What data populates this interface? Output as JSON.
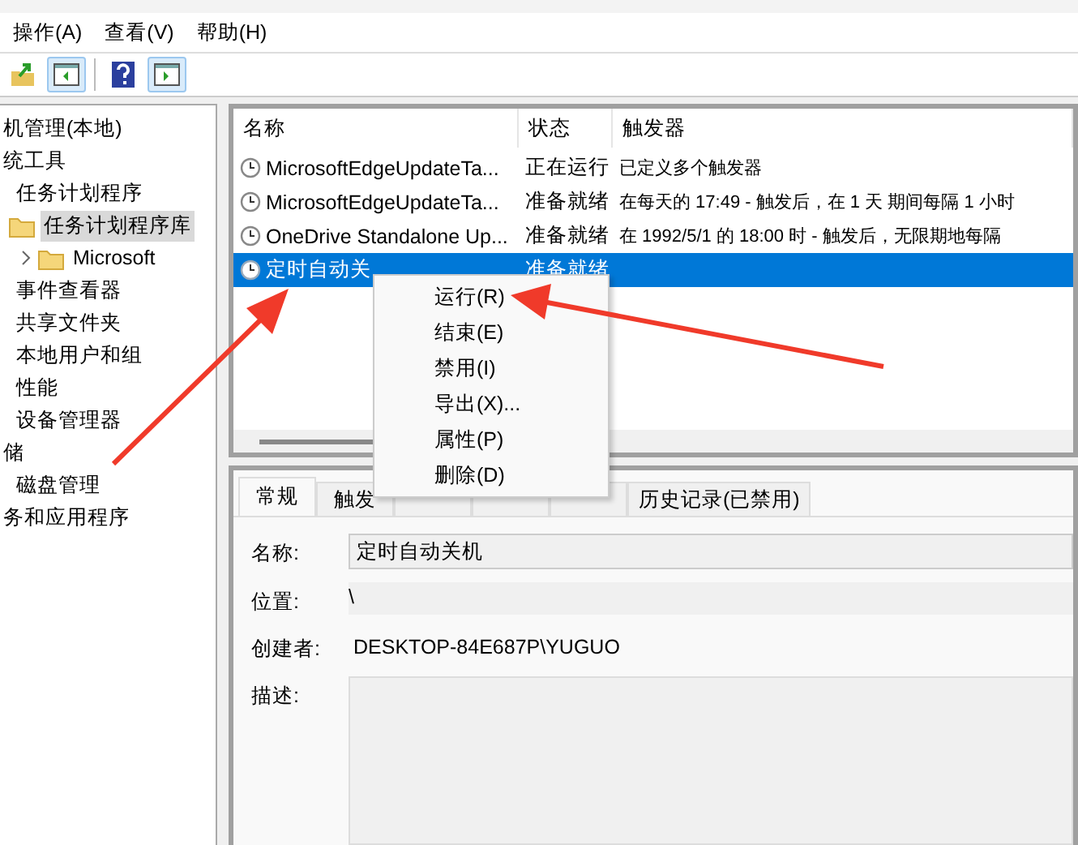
{
  "menu_bar": [
    "操作(A)",
    "查看(V)",
    "帮助(H)"
  ],
  "toolbar": [
    {
      "kind": "up",
      "pressed": false
    },
    {
      "kind": "tree",
      "pressed": true
    },
    {
      "kind": "help",
      "pressed": false
    },
    {
      "kind": "actions",
      "pressed": true
    }
  ],
  "tree": [
    {
      "label": "机管理(本地)",
      "selected": false,
      "children": [
        {
          "label": "统工具",
          "selected": false,
          "children": [
            {
              "label": "任务计划程序",
              "selected": false,
              "children": [
                {
                  "label": "任务计划程序库",
                  "selected": true,
                  "children": [
                    {
                      "label": "Microsoft",
                      "selected": false,
                      "expanded": false
                    }
                  ]
                }
              ]
            },
            {
              "label": "事件查看器",
              "selected": false
            },
            {
              "label": "共享文件夹",
              "selected": false
            },
            {
              "label": "本地用户和组",
              "selected": false
            },
            {
              "label": "性能",
              "selected": false
            },
            {
              "label": "设备管理器",
              "selected": false
            }
          ]
        },
        {
          "label": "储",
          "selected": false,
          "children": [
            {
              "label": "磁盘管理",
              "selected": false
            }
          ]
        },
        {
          "label": "务和应用程序",
          "selected": false
        }
      ]
    }
  ],
  "table": {
    "columns": [
      "名称",
      "状态",
      "触发器"
    ],
    "rows": [
      {
        "name": "MicrosoftEdgeUpdateTa...",
        "status": "正在运行",
        "trigger": "已定义多个触发器",
        "selected": false
      },
      {
        "name": "MicrosoftEdgeUpdateTa...",
        "status": "准备就绪",
        "trigger": "在每天的 17:49 - 触发后，在 1 天 期间每隔 1 小时",
        "selected": false
      },
      {
        "name": "OneDrive Standalone Up...",
        "status": "准备就绪",
        "trigger": "在 1992/5/1 的 18:00 时 - 触发后，无限期地每隔",
        "selected": false
      },
      {
        "name": "定时自动关",
        "status": "准备就绪",
        "selected": true
      }
    ]
  },
  "context_menu": [
    "运行(R)",
    "结束(E)",
    "禁用(I)",
    "导出(X)...",
    "属性(P)",
    "删除(D)"
  ],
  "detail_tabs": [
    {
      "label": "常规",
      "selected": true
    },
    {
      "label": "触发",
      "selected": false
    },
    {
      "selected": false
    },
    {
      "selected": false
    },
    {
      "selected": false
    },
    {
      "label": "历史记录(已禁用)",
      "selected": false
    }
  ],
  "general": {
    "name_label": "名称:",
    "name_value": "定时自动关机",
    "location_label": "位置:",
    "location_value": "\\",
    "author_label": "创建者:",
    "author_value": "DESKTOP-84E687P\\YUGUO",
    "description_label": "描述:"
  }
}
